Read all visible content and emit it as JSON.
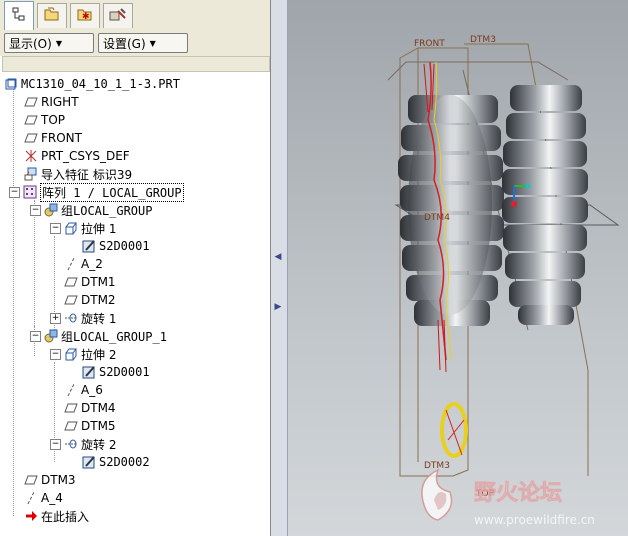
{
  "tabs": [
    {
      "icon": "model-tree-icon",
      "active": true
    },
    {
      "icon": "folder-browser-icon",
      "active": false
    },
    {
      "icon": "favorites-icon",
      "active": false
    },
    {
      "icon": "connections-icon",
      "active": false
    }
  ],
  "toolbar": {
    "show_label": "显示(O)",
    "settings_label": "设置(G)"
  },
  "tree": {
    "root": "MC1310_04_10_1_1-3.PRT",
    "right": "RIGHT",
    "top": "TOP",
    "front": "FRONT",
    "csys": "PRT_CSYS_DEF",
    "import": "导入特征 标识39",
    "pattern": "阵列 1 / LOCAL_GROUP",
    "group1": "组LOCAL_GROUP",
    "extrude1": "拉伸 1",
    "sketch1": "S2D0001",
    "a2": "A_2",
    "dtm1": "DTM1",
    "dtm2": "DTM2",
    "revolve1": "旋转 1",
    "group2": "组LOCAL_GROUP_1",
    "extrude2": "拉伸 2",
    "sketch2": "S2D0001",
    "a6": "A_6",
    "dtm4": "DTM4",
    "dtm5": "DTM5",
    "revolve2": "旋转 2",
    "sketch3": "S2D0002",
    "dtm3": "DTM3",
    "a4": "A_4",
    "insert": "在此插入"
  },
  "viewport": {
    "label_front": "FRONT",
    "label_dtm3_top": "DTM3",
    "label_dtm4": "DTM4",
    "label_dtm3_bottom": "DTM3",
    "label_top": "TOP",
    "watermark_title": "野火论坛",
    "watermark_url": "www.proewildfire.cn"
  },
  "colors": {
    "datum_plane": "#c8a76a",
    "gear_dark": "#3a3d42",
    "gear_light": "#e8eaec",
    "curve_red": "#d42020",
    "curve_yellow": "#e8d020"
  }
}
